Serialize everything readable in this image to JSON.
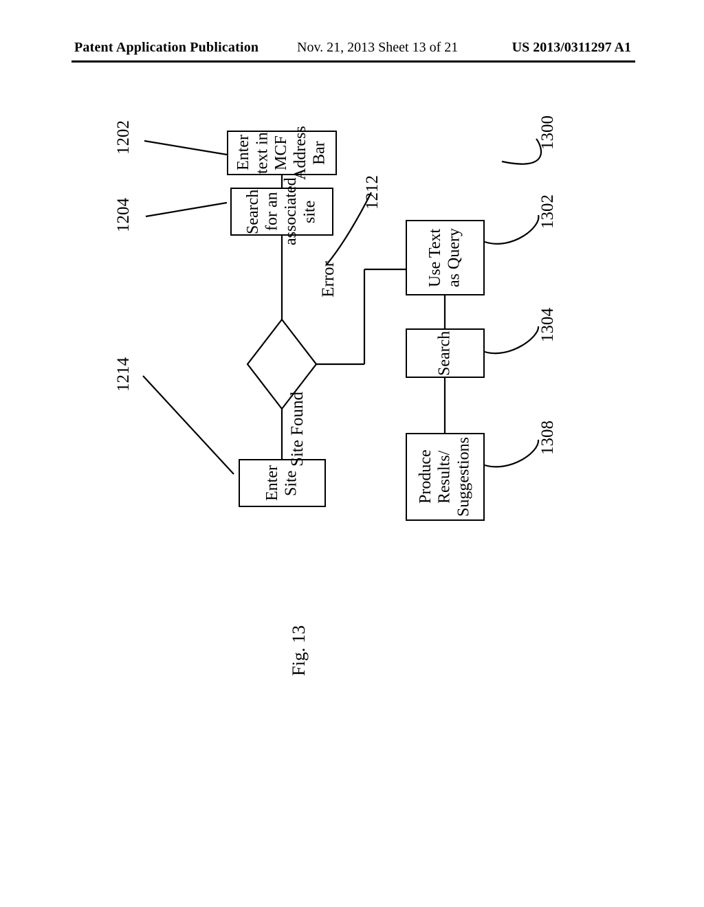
{
  "header": {
    "left": "Patent Application Publication",
    "mid": "Nov. 21, 2013  Sheet 13 of 21",
    "right": "US 2013/0311297 A1"
  },
  "ref": {
    "r1202": "1202",
    "r1204": "1204",
    "r1212": "1212",
    "r1214": "1214",
    "r1300": "1300",
    "r1302": "1302",
    "r1304": "1304",
    "r1308": "1308"
  },
  "boxes": {
    "enter_text": "Enter text in MCF\nAddress Bar",
    "search_assoc": "Search for an\nassociated site",
    "enter_site": "Enter Site",
    "use_query": "Use Text as\nQuery",
    "search": "Search",
    "produce": "Produce\nResults/\nSuggestions"
  },
  "edges": {
    "error": "Error",
    "site_found": "Site Found"
  },
  "caption": "Fig. 13"
}
